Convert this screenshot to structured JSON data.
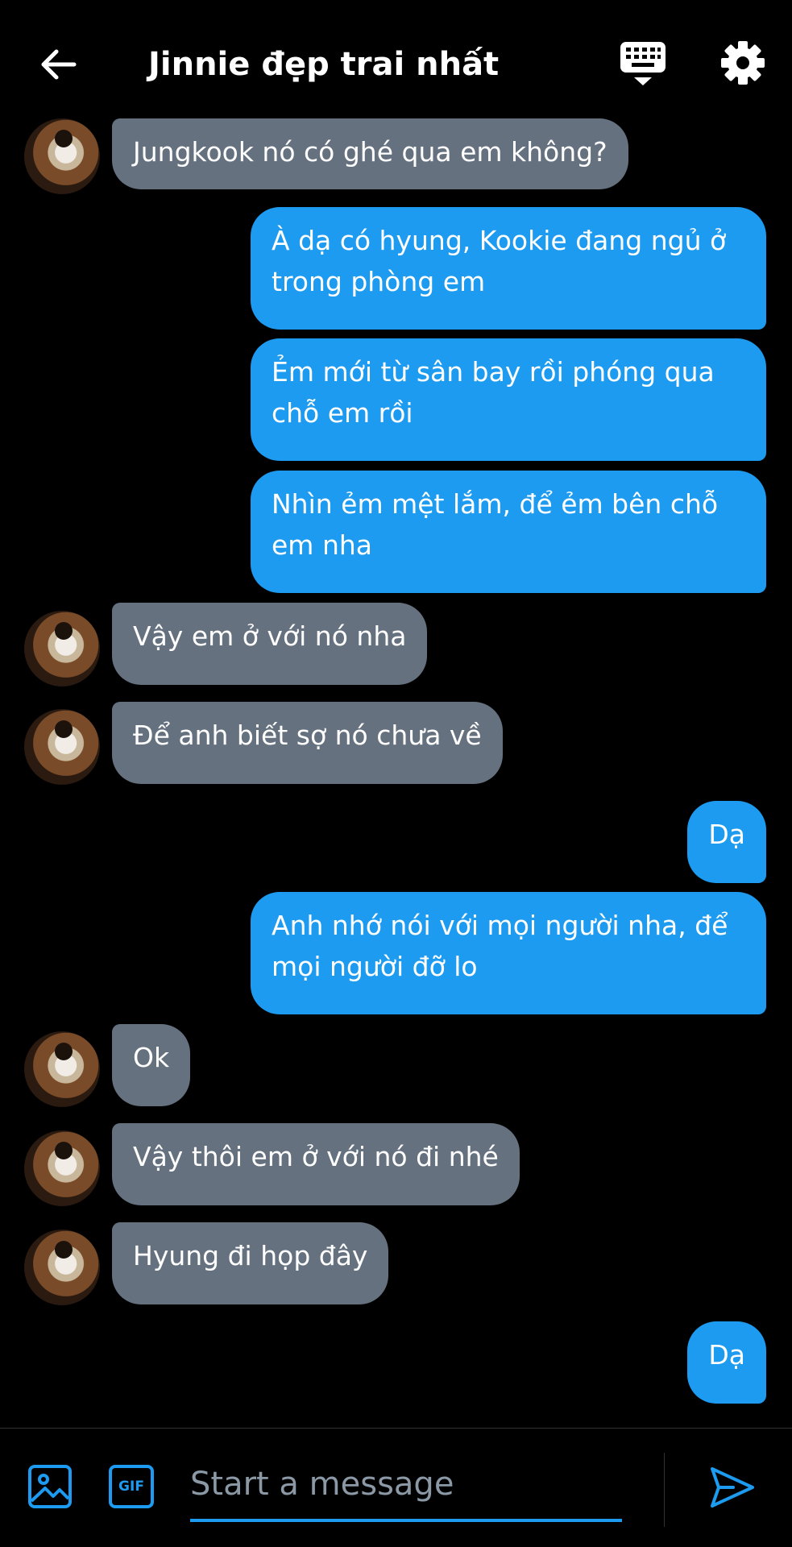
{
  "header": {
    "title": "Jinnie đẹp trai nhất",
    "back_icon": "arrow-left-icon",
    "keyboard_icon": "keyboard-icon",
    "settings_icon": "gear-icon"
  },
  "messages": [
    {
      "from": "other",
      "text": "Jungkook nó có ghé qua em không?"
    },
    {
      "from": "me",
      "text": "À dạ có hyung, Kookie đang ngủ ở trong phòng em"
    },
    {
      "from": "me",
      "text": "Ẻm mới từ sân bay rồi phóng qua chỗ em rồi"
    },
    {
      "from": "me",
      "text": "Nhìn ẻm mệt lắm, để ẻm bên chỗ em nha"
    },
    {
      "from": "other",
      "text": "Vậy em ở với nó nha"
    },
    {
      "from": "other",
      "text": "Để anh biết sợ nó chưa về"
    },
    {
      "from": "me",
      "text": "Dạ"
    },
    {
      "from": "me",
      "text": "Anh nhớ nói với mọi người nha, để mọi người đỡ lo"
    },
    {
      "from": "other",
      "text": "Ok"
    },
    {
      "from": "other",
      "text": "Vậy thôi em ở với nó đi nhé"
    },
    {
      "from": "other",
      "text": "Hyung đi họp đây"
    },
    {
      "from": "me",
      "text": "Dạ"
    }
  ],
  "composer": {
    "placeholder": "Start a message",
    "image_icon": "image-icon",
    "gif_label": "GIF",
    "send_icon": "send-icon"
  },
  "colors": {
    "background": "#000000",
    "sent_bubble": "#1d9bf0",
    "received_bubble": "#65717f",
    "accent": "#1d9bf0"
  }
}
